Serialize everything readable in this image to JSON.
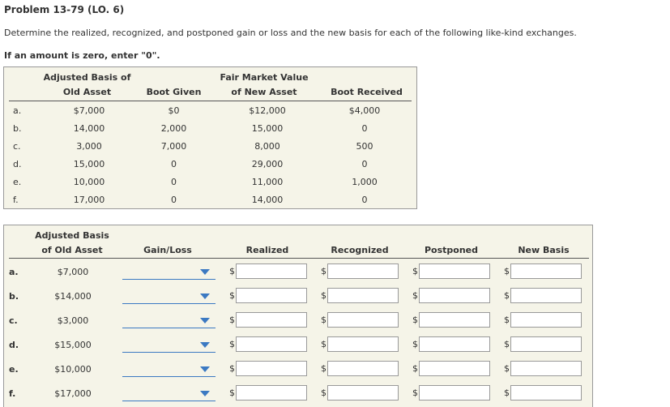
{
  "header": {
    "title": "Problem 13-79 (LO. 6)",
    "instruction": "Determine the realized, recognized, and postponed gain or loss and the new basis for each of the following like-kind exchanges.",
    "zero_note": "If an amount is zero, enter \"0\"."
  },
  "given_table": {
    "col_adj_line1": "Adjusted Basis of",
    "col_adj_line2": "Old Asset",
    "col_boot_given": "Boot Given",
    "col_fmv_line1": "Fair Market Value",
    "col_fmv_line2": "of New Asset",
    "col_boot_received": "Boot Received",
    "rows": [
      {
        "label": "a.",
        "adj": "$7,000",
        "boot_given": "$0",
        "fmv": "$12,000",
        "boot_received": "$4,000"
      },
      {
        "label": "b.",
        "adj": "14,000",
        "boot_given": "2,000",
        "fmv": "15,000",
        "boot_received": "0"
      },
      {
        "label": "c.",
        "adj": "3,000",
        "boot_given": "7,000",
        "fmv": "8,000",
        "boot_received": "500"
      },
      {
        "label": "d.",
        "adj": "15,000",
        "boot_given": "0",
        "fmv": "29,000",
        "boot_received": "0"
      },
      {
        "label": "e.",
        "adj": "10,000",
        "boot_given": "0",
        "fmv": "11,000",
        "boot_received": "1,000"
      },
      {
        "label": "f.",
        "adj": "17,000",
        "boot_given": "0",
        "fmv": "14,000",
        "boot_received": "0"
      }
    ]
  },
  "answer_table": {
    "col_adj_line1": "Adjusted Basis",
    "col_adj_line2": "of Old Asset",
    "col_gain_loss": "Gain/Loss",
    "col_realized": "Realized",
    "col_recognized": "Recognized",
    "col_postponed": "Postponed",
    "col_new_basis": "New Basis",
    "currency_symbol": "$",
    "rows": [
      {
        "label": "a.",
        "adj": "$7,000"
      },
      {
        "label": "b.",
        "adj": "$14,000"
      },
      {
        "label": "c.",
        "adj": "$3,000"
      },
      {
        "label": "d.",
        "adj": "$15,000"
      },
      {
        "label": "e.",
        "adj": "$10,000"
      },
      {
        "label": "f.",
        "adj": "$17,000"
      }
    ]
  },
  "colors": {
    "panel_bg": "#f5f4e8",
    "dropdown_accent": "#3b79c2"
  }
}
